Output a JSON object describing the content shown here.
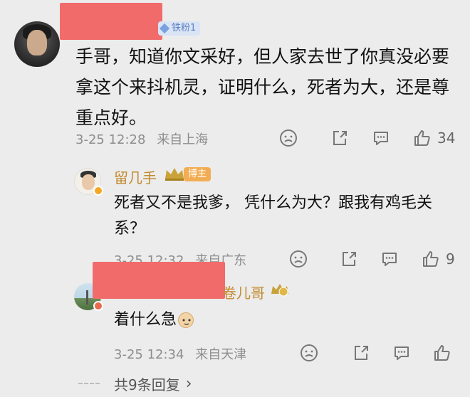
{
  "main_comment": {
    "fan_badge": "铁粉1",
    "text": "手哥，知道你文采好，但人家去世了你真没必要拿这个来抖机灵，证明什么，死者为大，还是尊重点好。",
    "time": "3-25 12:28",
    "location": "来自上海",
    "like_count": "34"
  },
  "replies": [
    {
      "username": "留几手",
      "role_badge": "博主",
      "text": "死者又不是我爹， 凭什么为大？跟我有鸡毛关系？",
      "time": "3-25 12:32",
      "location": "来自广东",
      "like_count": "9"
    },
    {
      "username_visible": "卷儿哥",
      "text": "着什么急",
      "time": "3-25 12:34",
      "location": "来自天津"
    }
  ],
  "more_replies": {
    "label": "共9条回复",
    "chevron": "›"
  },
  "icons": [
    "dislike-icon",
    "share-icon",
    "comment-icon",
    "like-icon",
    "chevron-right-icon",
    "verified-icon",
    "crown-icon",
    "cat-emoji-icon"
  ],
  "colors": {
    "background": "#ececec",
    "redaction": "#f26b6b",
    "blogger_name": "#c28a2e",
    "blogger_badge": "#f2ad54",
    "fan_badge_bg": "#d9e4f5",
    "meta_text": "#8d8d8d"
  }
}
